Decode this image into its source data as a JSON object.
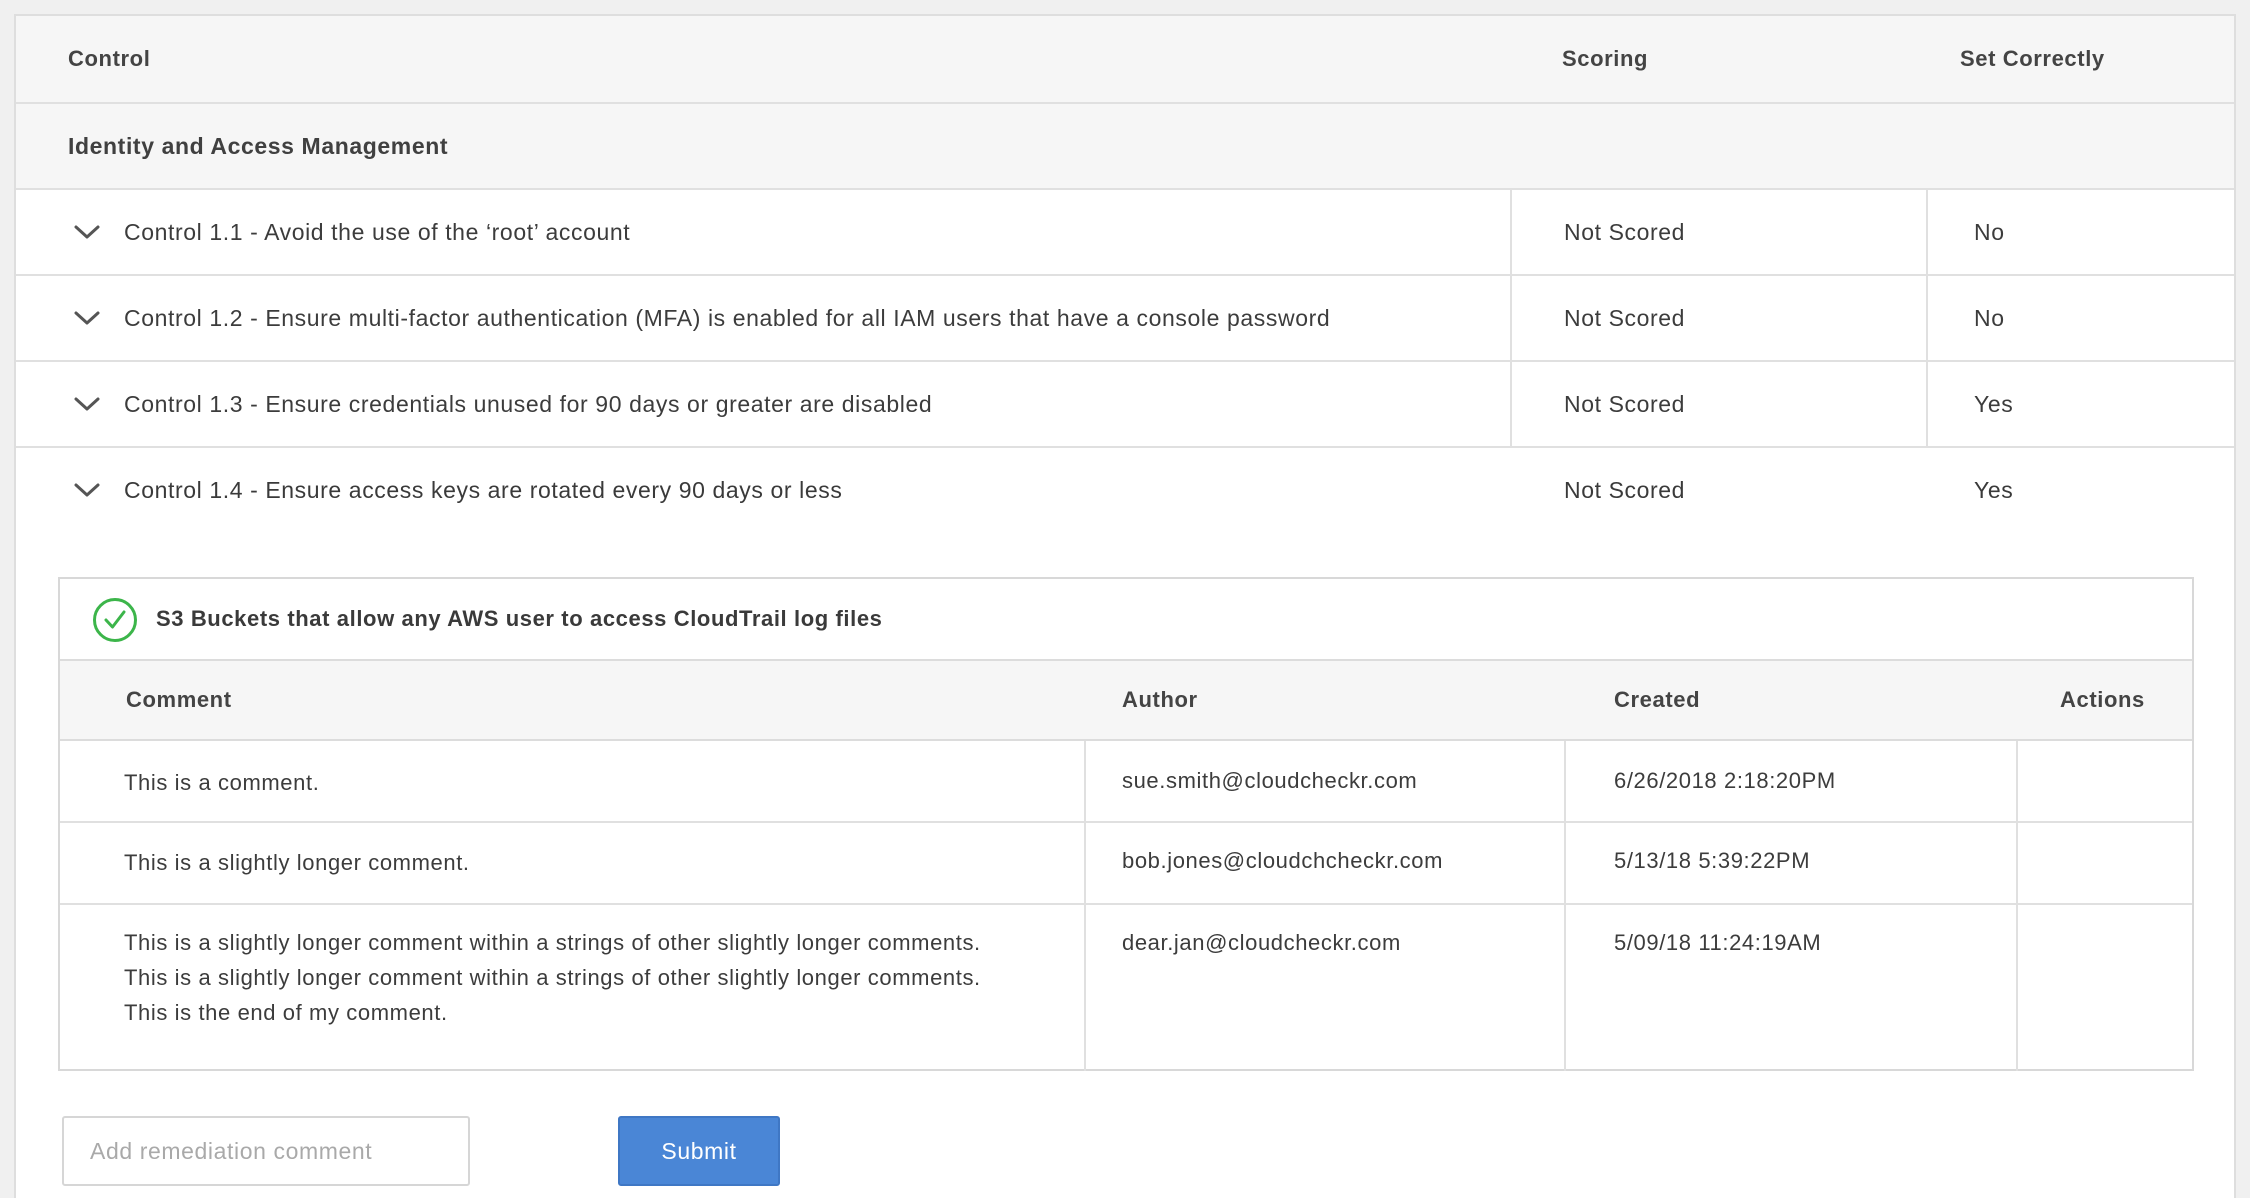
{
  "table": {
    "headers": {
      "control": "Control",
      "scoring": "Scoring",
      "set_correctly": "Set Correctly"
    },
    "section": {
      "title": "Identity and Access Management"
    },
    "controls": [
      {
        "label": "Control 1.1 - Avoid the use of the ‘root’ account",
        "scoring": "Not Scored",
        "set_correctly": "No",
        "icon": "chevron-down-icon"
      },
      {
        "label": "Control 1.2 - Ensure multi-factor authentication (MFA) is enabled for all IAM users that have a console password",
        "scoring": "Not Scored",
        "set_correctly": "No",
        "icon": "chevron-down-icon"
      },
      {
        "label": "Control 1.3 - Ensure credentials unused for 90 days or greater are disabled",
        "scoring": "Not Scored",
        "set_correctly": "Yes",
        "icon": "chevron-down-icon"
      },
      {
        "label": "Control 1.4 - Ensure access keys are rotated every 90 days or less",
        "scoring": "Not Scored",
        "set_correctly": "Yes",
        "icon": "chevron-down-icon"
      }
    ]
  },
  "detail": {
    "title": "S3 Buckets that allow any AWS user to access CloudTrail log files",
    "status_icon": "check-circle-icon",
    "status_color": "#3cb54a",
    "comments_table": {
      "headers": {
        "comment": "Comment",
        "author": "Author",
        "created": "Created",
        "actions": "Actions"
      },
      "rows": [
        {
          "comment": "This is a comment.",
          "author": "sue.smith@cloudcheckr.com",
          "created": "6/26/2018 2:18:20PM"
        },
        {
          "comment": "This is a slightly longer comment.",
          "author": "bob.jones@cloudchcheckr.com",
          "created": "5/13/18 5:39:22PM"
        },
        {
          "comment": "This is a slightly longer comment within a strings of other slightly longer comments.\nThis is a slightly longer comment within a strings of other slightly longer comments.\nThis is the end of my comment.",
          "author": "dear.jan@cloudcheckr.com",
          "created": "5/09/18 11:24:19AM"
        }
      ]
    }
  },
  "remediation": {
    "placeholder": "Add remediation comment",
    "value": "",
    "submit_label": "Submit",
    "submit_color": "#4a86d6"
  }
}
